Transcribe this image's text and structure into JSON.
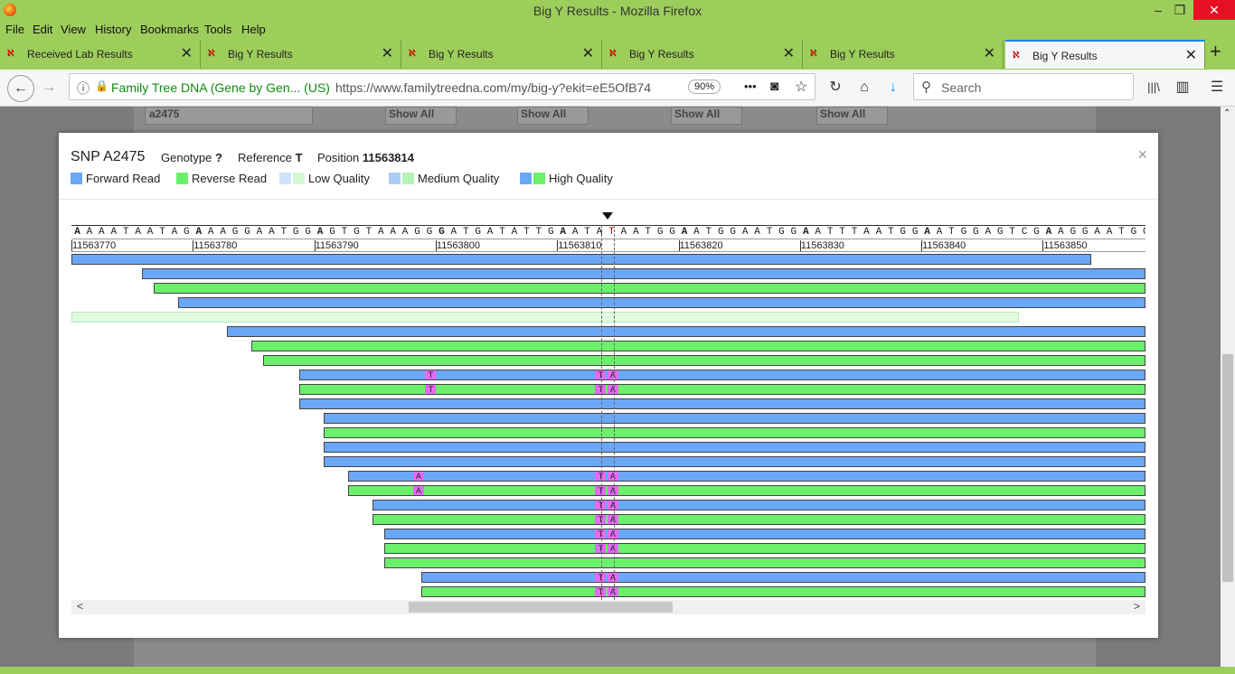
{
  "window": {
    "title": "Big Y Results - Mozilla Firefox",
    "min": "‒",
    "max": "❐",
    "close": "✕"
  },
  "menu": [
    "File",
    "Edit",
    "View",
    "History",
    "Bookmarks",
    "Tools",
    "Help"
  ],
  "tabs": [
    {
      "label": "Received Lab Results",
      "active": false
    },
    {
      "label": "Big Y Results",
      "active": false
    },
    {
      "label": "Big Y Results",
      "active": false
    },
    {
      "label": "Big Y Results",
      "active": false
    },
    {
      "label": "Big Y Results",
      "active": false
    },
    {
      "label": "Big Y Results",
      "active": true
    }
  ],
  "tab_close": "✕",
  "new_tab": "+",
  "nav": {
    "back": "←",
    "forward": "→",
    "site_identity": "Family Tree DNA (Gene by Gen...  (US)",
    "url": "https://www.familytreedna.com/my/big-y?ekit=eE5OfB74",
    "zoom": "90%",
    "more": "•••",
    "search_placeholder": "Search",
    "reload": "↻",
    "home": "⌂",
    "download": "↓",
    "library": "|||\\",
    "sidebar": "▥",
    "menu": "☰"
  },
  "background": {
    "field_value": "a2475",
    "show_all": [
      "Show All",
      "Show All",
      "Show All",
      "Show All"
    ]
  },
  "modal": {
    "title": "SNP A2475",
    "genotype_label": "Genotype",
    "genotype_value": "?",
    "reference_label": "Reference",
    "reference_value": "T",
    "position_label": "Position",
    "position_value": "11563814",
    "close": "×",
    "legend": [
      {
        "label": "Forward Read",
        "colors": [
          "#6aa7f6"
        ]
      },
      {
        "label": "Reverse Read",
        "colors": [
          "#6bf06b"
        ]
      },
      {
        "label": "Low Quality",
        "colors": [
          "#cfe4fb",
          "#d4f7d4"
        ]
      },
      {
        "label": "Medium Quality",
        "colors": [
          "#a9cdf6",
          "#b4f4b4"
        ]
      },
      {
        "label": "High Quality",
        "colors": [
          "#6aa7f6",
          "#6bf06b"
        ]
      }
    ]
  },
  "sequence": "AAAATAATAGAAAGGAATGGAGTGTAAAGGGATGATATTGAATATAATGGAATGGAATGGAATTTAATGGAATGGAGTCGAAGGAATGG",
  "bold_positions": [
    0,
    10,
    20,
    30,
    40,
    50,
    60,
    70,
    80
  ],
  "highlight_index": 44,
  "positions": [
    "11563770",
    "11563780",
    "11563790",
    "11563800",
    "11563810",
    "11563820",
    "11563830",
    "11563840",
    "11563850"
  ],
  "reads": [
    {
      "type": "fwd",
      "start": 0,
      "end": 84,
      "mm": []
    },
    {
      "type": "fwd",
      "start": 5.8,
      "end": 91,
      "mm": []
    },
    {
      "type": "rev",
      "start": 6.8,
      "end": 91,
      "mm": []
    },
    {
      "type": "fwd",
      "start": 8.8,
      "end": 91,
      "mm": []
    },
    {
      "type": "low",
      "start": 0,
      "end": 78,
      "mm": []
    },
    {
      "type": "fwd",
      "start": 12.8,
      "end": 91,
      "mm": []
    },
    {
      "type": "rev",
      "start": 14.8,
      "end": 91,
      "mm": []
    },
    {
      "type": "rev",
      "start": 15.8,
      "end": 91,
      "mm": []
    },
    {
      "type": "fwd",
      "start": 18.8,
      "end": 91,
      "mm": [
        {
          "i": 29,
          "b": "T"
        },
        {
          "i": 43,
          "b": "T"
        },
        {
          "i": 44,
          "b": "A"
        }
      ]
    },
    {
      "type": "rev",
      "start": 18.8,
      "end": 91,
      "mm": [
        {
          "i": 29,
          "b": "T"
        },
        {
          "i": 43,
          "b": "T"
        },
        {
          "i": 44,
          "b": "A"
        }
      ]
    },
    {
      "type": "fwd",
      "start": 18.8,
      "end": 91,
      "mm": []
    },
    {
      "type": "fwd",
      "start": 20.8,
      "end": 91,
      "mm": []
    },
    {
      "type": "rev",
      "start": 20.8,
      "end": 91,
      "mm": []
    },
    {
      "type": "fwd",
      "start": 20.8,
      "end": 91,
      "mm": []
    },
    {
      "type": "fwd",
      "start": 20.8,
      "end": 91,
      "mm": []
    },
    {
      "type": "fwd",
      "start": 22.8,
      "end": 91,
      "mm": [
        {
          "i": 28,
          "b": "A"
        },
        {
          "i": 43,
          "b": "T"
        },
        {
          "i": 44,
          "b": "A"
        }
      ]
    },
    {
      "type": "rev",
      "start": 22.8,
      "end": 91,
      "mm": [
        {
          "i": 28,
          "b": "A"
        },
        {
          "i": 43,
          "b": "T"
        },
        {
          "i": 44,
          "b": "A"
        }
      ]
    },
    {
      "type": "fwd",
      "start": 24.8,
      "end": 91,
      "mm": [
        {
          "i": 43,
          "b": "T"
        },
        {
          "i": 44,
          "b": "A"
        }
      ]
    },
    {
      "type": "rev",
      "start": 24.8,
      "end": 91,
      "mm": [
        {
          "i": 43,
          "b": "T"
        },
        {
          "i": 44,
          "b": "A"
        }
      ]
    },
    {
      "type": "fwd",
      "start": 25.8,
      "end": 91,
      "mm": [
        {
          "i": 43,
          "b": "T"
        },
        {
          "i": 44,
          "b": "A"
        }
      ]
    },
    {
      "type": "rev",
      "start": 25.8,
      "end": 91,
      "mm": [
        {
          "i": 43,
          "b": "T"
        },
        {
          "i": 44,
          "b": "A"
        }
      ]
    },
    {
      "type": "rev",
      "start": 25.8,
      "end": 91,
      "mm": []
    },
    {
      "type": "fwd",
      "start": 28.8,
      "end": 91,
      "mm": [
        {
          "i": 43,
          "b": "T"
        },
        {
          "i": 44,
          "b": "A"
        }
      ]
    },
    {
      "type": "rev",
      "start": 28.8,
      "end": 91,
      "mm": [
        {
          "i": 43,
          "b": "T"
        },
        {
          "i": 44,
          "b": "A"
        }
      ]
    }
  ],
  "scroll": {
    "left": "<",
    "right": ">"
  }
}
